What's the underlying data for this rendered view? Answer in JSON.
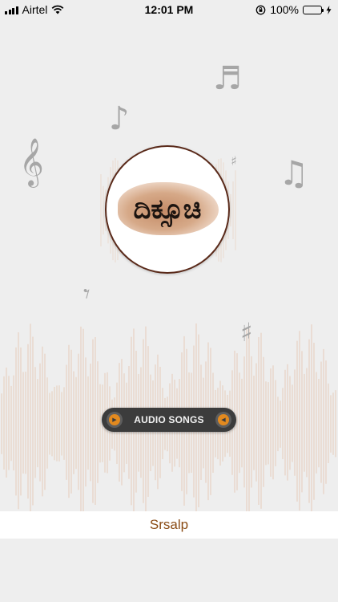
{
  "status_bar": {
    "carrier": "Airtel",
    "time": "12:01 PM",
    "battery_percent": "100%",
    "signal_bars": 4,
    "battery_level": 1.0
  },
  "logo": {
    "text": "ದಿಕ್ಸೂಚಿ"
  },
  "audio_button": {
    "label": "AUDIO SONGS",
    "left_icon": "play-arrow-icon",
    "right_icon": "reverse-arrow-icon"
  },
  "footer": {
    "label": "Srsalp"
  },
  "colors": {
    "background": "#eeeeee",
    "accent": "#e38a1f",
    "footer_text": "#8a4b14",
    "pill": "#3c3c3c",
    "battery": "#4cd964"
  }
}
